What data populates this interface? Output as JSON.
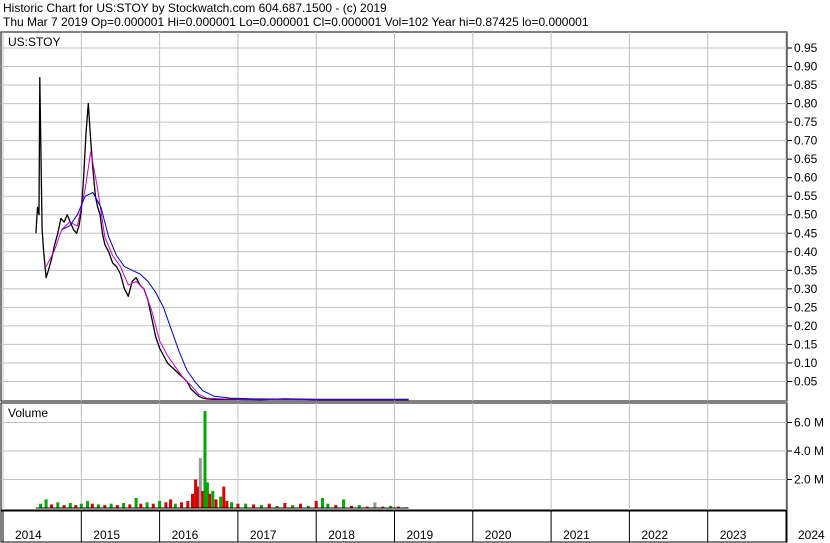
{
  "header": {
    "line1": "Historic Chart for US:STOY by Stockwatch.com 604.687.1500 - (c) 2019",
    "line2": "Thu Mar  7 2019  Op=0.000001  Hi=0.000001  Lo=0.000001  Cl=0.000001   Vol=102   Year hi=0.87425   lo=0.000001"
  },
  "colors": {
    "price": "#000000",
    "ma_short": "#cc00cc",
    "ma_long": "#0000cc",
    "volume_up": "#00aa00",
    "volume_down": "#dd0000",
    "volume_flat": "#999999",
    "grid": "#c0c0c0"
  },
  "chart_data": [
    {
      "type": "line",
      "title": "US:STOY",
      "y_ticks": [
        "0.95",
        "0.90",
        "0.85",
        "0.80",
        "0.75",
        "0.70",
        "0.65",
        "0.60",
        "0.55",
        "0.50",
        "0.45",
        "0.40",
        "0.35",
        "0.30",
        "0.25",
        "0.20",
        "0.15",
        "0.10",
        "0.05"
      ],
      "ylim": [
        0,
        0.97
      ],
      "x_range": [
        2014.0,
        2024.3
      ],
      "series": [
        {
          "key": "close",
          "color": "#000000",
          "x": [
            2014.42,
            2014.44,
            2014.46,
            2014.47,
            2014.5,
            2014.52,
            2014.55,
            2014.58,
            2014.62,
            2014.66,
            2014.7,
            2014.74,
            2014.78,
            2014.82,
            2014.86,
            2014.9,
            2014.94,
            2014.97,
            2015.0,
            2015.03,
            2015.06,
            2015.09,
            2015.12,
            2015.15,
            2015.18,
            2015.21,
            2015.24,
            2015.27,
            2015.3,
            2015.35,
            2015.4,
            2015.45,
            2015.5,
            2015.55,
            2015.6,
            2015.65,
            2015.7,
            2015.75,
            2015.8,
            2015.85,
            2015.9,
            2015.95,
            2016.0,
            2016.05,
            2016.1,
            2016.15,
            2016.2,
            2016.25,
            2016.3,
            2016.35,
            2016.4,
            2016.45,
            2016.5,
            2016.55,
            2016.6,
            2016.7,
            2016.8,
            2017.0,
            2017.3,
            2017.6,
            2018.0,
            2018.4,
            2018.8,
            2019.18
          ],
          "y": [
            0.45,
            0.52,
            0.5,
            0.87,
            0.46,
            0.4,
            0.33,
            0.35,
            0.38,
            0.42,
            0.45,
            0.49,
            0.48,
            0.5,
            0.48,
            0.46,
            0.45,
            0.47,
            0.51,
            0.6,
            0.72,
            0.8,
            0.7,
            0.62,
            0.55,
            0.52,
            0.5,
            0.45,
            0.42,
            0.4,
            0.37,
            0.36,
            0.34,
            0.3,
            0.28,
            0.32,
            0.33,
            0.31,
            0.3,
            0.27,
            0.22,
            0.17,
            0.14,
            0.12,
            0.1,
            0.09,
            0.08,
            0.07,
            0.06,
            0.05,
            0.03,
            0.02,
            0.01,
            0.005,
            0.003,
            0.002,
            0.002,
            0.002,
            0.001,
            0.003,
            0.001,
            0.001,
            0.001,
            0.001
          ]
        },
        {
          "key": "ma_short",
          "color": "#cc00cc",
          "x": [
            2014.55,
            2014.65,
            2014.75,
            2014.85,
            2014.95,
            2015.05,
            2015.12,
            2015.2,
            2015.3,
            2015.4,
            2015.5,
            2015.6,
            2015.7,
            2015.8,
            2015.9,
            2016.0,
            2016.1,
            2016.2,
            2016.3,
            2016.4,
            2016.5,
            2016.6,
            2016.8,
            2017.2,
            2018.0,
            2019.18
          ],
          "y": [
            0.36,
            0.4,
            0.46,
            0.48,
            0.47,
            0.57,
            0.67,
            0.58,
            0.44,
            0.39,
            0.36,
            0.31,
            0.32,
            0.3,
            0.24,
            0.16,
            0.12,
            0.09,
            0.06,
            0.04,
            0.015,
            0.005,
            0.003,
            0.002,
            0.001,
            0.001
          ]
        },
        {
          "key": "ma_long",
          "color": "#0000cc",
          "x": [
            2014.75,
            2014.85,
            2014.95,
            2015.05,
            2015.15,
            2015.25,
            2015.35,
            2015.45,
            2015.55,
            2015.65,
            2015.75,
            2015.85,
            2015.95,
            2016.05,
            2016.15,
            2016.25,
            2016.35,
            2016.45,
            2016.55,
            2016.7,
            2016.9,
            2017.2,
            2018.0,
            2019.18
          ],
          "y": [
            0.46,
            0.47,
            0.5,
            0.55,
            0.56,
            0.52,
            0.44,
            0.39,
            0.36,
            0.35,
            0.34,
            0.32,
            0.29,
            0.25,
            0.19,
            0.13,
            0.08,
            0.05,
            0.025,
            0.01,
            0.005,
            0.003,
            0.002,
            0.002
          ]
        }
      ]
    },
    {
      "type": "bar",
      "title": "Volume",
      "y_ticks": [
        "6.0 M",
        "4.0 M",
        "2.0 M"
      ],
      "ylim": [
        0,
        7.3
      ],
      "bars": [
        {
          "x": 2014.48,
          "v": 0.3,
          "c": "up"
        },
        {
          "x": 2014.55,
          "v": 0.6,
          "c": "up"
        },
        {
          "x": 2014.62,
          "v": 0.25,
          "c": "down"
        },
        {
          "x": 2014.7,
          "v": 0.4,
          "c": "up"
        },
        {
          "x": 2014.78,
          "v": 0.2,
          "c": "down"
        },
        {
          "x": 2014.86,
          "v": 0.35,
          "c": "up"
        },
        {
          "x": 2014.93,
          "v": 0.2,
          "c": "down"
        },
        {
          "x": 2015.0,
          "v": 0.3,
          "c": "up"
        },
        {
          "x": 2015.08,
          "v": 0.5,
          "c": "up"
        },
        {
          "x": 2015.14,
          "v": 0.3,
          "c": "down"
        },
        {
          "x": 2015.22,
          "v": 0.25,
          "c": "up"
        },
        {
          "x": 2015.3,
          "v": 0.2,
          "c": "down"
        },
        {
          "x": 2015.38,
          "v": 0.3,
          "c": "up"
        },
        {
          "x": 2015.46,
          "v": 0.2,
          "c": "down"
        },
        {
          "x": 2015.54,
          "v": 0.35,
          "c": "up"
        },
        {
          "x": 2015.62,
          "v": 0.25,
          "c": "down"
        },
        {
          "x": 2015.7,
          "v": 0.7,
          "c": "up"
        },
        {
          "x": 2015.76,
          "v": 0.3,
          "c": "down"
        },
        {
          "x": 2015.84,
          "v": 0.4,
          "c": "up"
        },
        {
          "x": 2015.92,
          "v": 0.3,
          "c": "down"
        },
        {
          "x": 2016.0,
          "v": 0.5,
          "c": "up"
        },
        {
          "x": 2016.08,
          "v": 0.4,
          "c": "down"
        },
        {
          "x": 2016.14,
          "v": 0.6,
          "c": "down"
        },
        {
          "x": 2016.2,
          "v": 0.3,
          "c": "up"
        },
        {
          "x": 2016.28,
          "v": 0.4,
          "c": "down"
        },
        {
          "x": 2016.36,
          "v": 0.5,
          "c": "down"
        },
        {
          "x": 2016.42,
          "v": 1.0,
          "c": "down"
        },
        {
          "x": 2016.46,
          "v": 2.0,
          "c": "down"
        },
        {
          "x": 2016.49,
          "v": 1.5,
          "c": "down"
        },
        {
          "x": 2016.52,
          "v": 3.5,
          "c": "flat"
        },
        {
          "x": 2016.55,
          "v": 1.2,
          "c": "down"
        },
        {
          "x": 2016.58,
          "v": 6.8,
          "c": "up"
        },
        {
          "x": 2016.61,
          "v": 1.8,
          "c": "up"
        },
        {
          "x": 2016.64,
          "v": 1.0,
          "c": "down"
        },
        {
          "x": 2016.68,
          "v": 1.2,
          "c": "up"
        },
        {
          "x": 2016.72,
          "v": 0.6,
          "c": "down"
        },
        {
          "x": 2016.78,
          "v": 0.8,
          "c": "up"
        },
        {
          "x": 2016.82,
          "v": 1.5,
          "c": "down"
        },
        {
          "x": 2016.86,
          "v": 0.5,
          "c": "down"
        },
        {
          "x": 2016.92,
          "v": 0.4,
          "c": "up"
        },
        {
          "x": 2017.0,
          "v": 0.3,
          "c": "down"
        },
        {
          "x": 2017.1,
          "v": 0.3,
          "c": "up"
        },
        {
          "x": 2017.2,
          "v": 0.25,
          "c": "down"
        },
        {
          "x": 2017.3,
          "v": 0.2,
          "c": "up"
        },
        {
          "x": 2017.4,
          "v": 0.3,
          "c": "down"
        },
        {
          "x": 2017.5,
          "v": 0.15,
          "c": "up"
        },
        {
          "x": 2017.6,
          "v": 0.35,
          "c": "down"
        },
        {
          "x": 2017.7,
          "v": 0.2,
          "c": "up"
        },
        {
          "x": 2017.8,
          "v": 0.3,
          "c": "down"
        },
        {
          "x": 2017.9,
          "v": 0.15,
          "c": "up"
        },
        {
          "x": 2018.0,
          "v": 0.5,
          "c": "down"
        },
        {
          "x": 2018.08,
          "v": 0.7,
          "c": "up"
        },
        {
          "x": 2018.15,
          "v": 0.3,
          "c": "up"
        },
        {
          "x": 2018.25,
          "v": 0.2,
          "c": "down"
        },
        {
          "x": 2018.35,
          "v": 0.6,
          "c": "up"
        },
        {
          "x": 2018.45,
          "v": 0.15,
          "c": "down"
        },
        {
          "x": 2018.55,
          "v": 0.2,
          "c": "up"
        },
        {
          "x": 2018.65,
          "v": 0.1,
          "c": "down"
        },
        {
          "x": 2018.75,
          "v": 0.4,
          "c": "flat"
        },
        {
          "x": 2018.85,
          "v": 0.1,
          "c": "down"
        },
        {
          "x": 2018.95,
          "v": 0.15,
          "c": "up"
        },
        {
          "x": 2019.05,
          "v": 0.1,
          "c": "down"
        },
        {
          "x": 2019.15,
          "v": 0.05,
          "c": "up"
        }
      ]
    }
  ],
  "x_axis": {
    "labels": [
      {
        "year": 2014.0,
        "label": "2014"
      },
      {
        "year": 2015.0,
        "label": "2015"
      },
      {
        "year": 2016.0,
        "label": "2016"
      },
      {
        "year": 2017.0,
        "label": "2017"
      },
      {
        "year": 2018.0,
        "label": "2018"
      },
      {
        "year": 2019.0,
        "label": "2019"
      },
      {
        "year": 2020.0,
        "label": "2020"
      },
      {
        "year": 2021.0,
        "label": "2021"
      },
      {
        "year": 2022.0,
        "label": "2022"
      },
      {
        "year": 2023.0,
        "label": "2023"
      },
      {
        "year": 2024.0,
        "label": "2024"
      }
    ]
  }
}
